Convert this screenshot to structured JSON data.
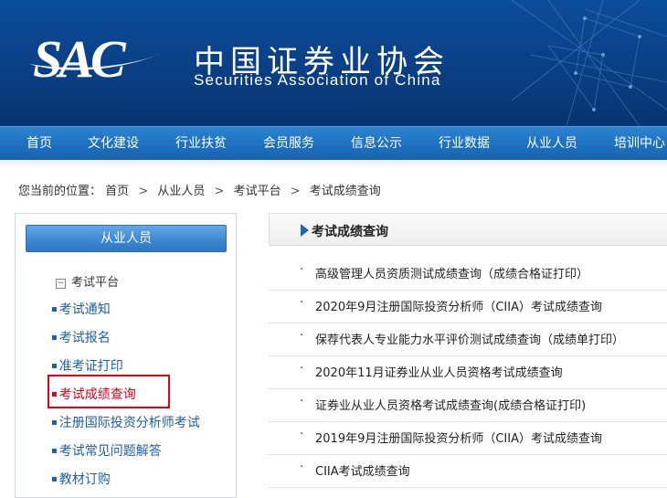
{
  "header": {
    "logo_text": "SAC",
    "cn_name": "中国证券业协会",
    "en_name": "Securities Association of China"
  },
  "nav": [
    "首页",
    "文化建设",
    "行业扶贫",
    "会员服务",
    "信息公示",
    "行业数据",
    "从业人员",
    "培训中心"
  ],
  "breadcrumb": {
    "prefix": "您当前的位置：",
    "items": [
      "首页",
      "从业人员",
      "考试平台",
      "考试成绩查询"
    ],
    "separator": ">"
  },
  "sidebar": {
    "header": "从业人员",
    "group_toggle": "−",
    "group_label": "考试平台",
    "links": [
      "考试通知",
      "考试报名",
      "准考证打印",
      "考试成绩查询",
      "注册国际投资分析师考试",
      "考试常见问题解答",
      "教材订购"
    ],
    "active_index": 3,
    "dot": "▪"
  },
  "main": {
    "title": "考试成绩查询",
    "bullet": "·",
    "items": [
      "高级管理人员资质测试成绩查询（成绩合格证打印）",
      "2020年9月注册国际投资分析师（CIIA）考试成绩查询",
      "保荐代表人专业能力水平评价测试成绩查询（成绩单打印）",
      "2020年11月证券业从业人员资格考试成绩查询",
      "证券业从业人员资格考试成绩查询(成绩合格证打印)",
      "2019年9月注册国际投资分析师（CIIA）考试成绩查询",
      "CIIA考试成绩查询"
    ]
  },
  "colors": {
    "banner": "#0a3f85",
    "nav": "#1c6fbe",
    "link": "#1d5ea8",
    "active": "#d9001b",
    "highlight_border": "#e60012"
  }
}
